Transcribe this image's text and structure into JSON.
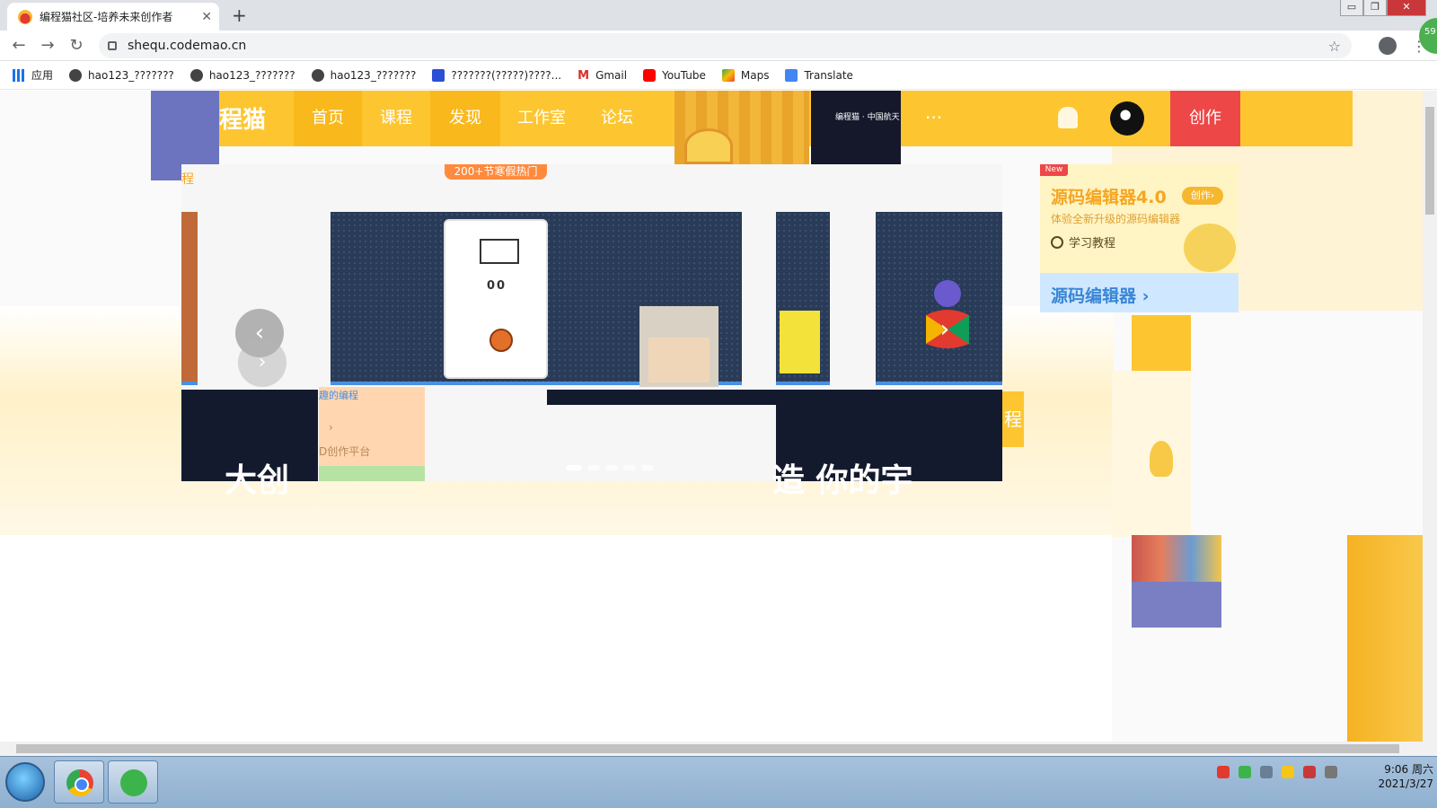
{
  "browser": {
    "tab_title": "编程猫社区-培养未来创作者",
    "tab_close": "✕",
    "new_tab": "+",
    "url": "shequ.codemao.cn",
    "nav": {
      "back": "←",
      "forward": "→",
      "reload": "↻"
    },
    "star": "☆",
    "menu": "⋮",
    "window_controls": {
      "minimize": "▭",
      "restore": "❐",
      "close": "✕"
    },
    "extension_badge": "59",
    "bookmarks": [
      {
        "label": "应用",
        "icon": "apps-icon"
      },
      {
        "label": "hao123_???????",
        "icon": "globe-icon"
      },
      {
        "label": "hao123_???????",
        "icon": "globe-icon"
      },
      {
        "label": "hao123_???????",
        "icon": "globe-icon"
      },
      {
        "label": "???????(?????)????...",
        "icon": "paw-icon"
      },
      {
        "label": "Gmail",
        "icon": "gmail-icon"
      },
      {
        "label": "YouTube",
        "icon": "youtube-icon"
      },
      {
        "label": "Maps",
        "icon": "maps-icon"
      },
      {
        "label": "Translate",
        "icon": "translate-icon"
      }
    ]
  },
  "site": {
    "logo": "程猫",
    "nav": {
      "home": "首页",
      "course": "课程",
      "discover": "发现",
      "studio": "工作室",
      "forum": "论坛"
    },
    "more": "···",
    "create": "创作",
    "partner_text": "编程猫 · 中国航天",
    "banner": {
      "promo_tag": "200+节寒假热门",
      "side_tag": "程",
      "carousel_prev": "‹",
      "carousel_next": "›",
      "carousel_next_ghost": "›",
      "hoop_score": "00",
      "peach_text_1": "趣的编程",
      "peach_arrow": "›",
      "peach_text_2": "D创作平台",
      "big_text_1": "大创",
      "big_text_2": "造 你的宇",
      "yellow_chip": "程"
    },
    "editor": {
      "new_badge": "New",
      "title": "源码编辑器4.0",
      "create_chip": "创作›",
      "subtitle": "体验全新升级的源码编辑器",
      "tutorial": "学习教程",
      "title2": "源码编辑器 ›"
    }
  },
  "taskbar": {
    "time": "9:06 周六",
    "date": "2021/3/27"
  },
  "colors": {
    "header_yellow": "#fdc630",
    "header_active": "#f9b81c",
    "create_red": "#ee4747",
    "editor_accent": "#f5a623",
    "editor2_blue": "#3a86d6"
  }
}
